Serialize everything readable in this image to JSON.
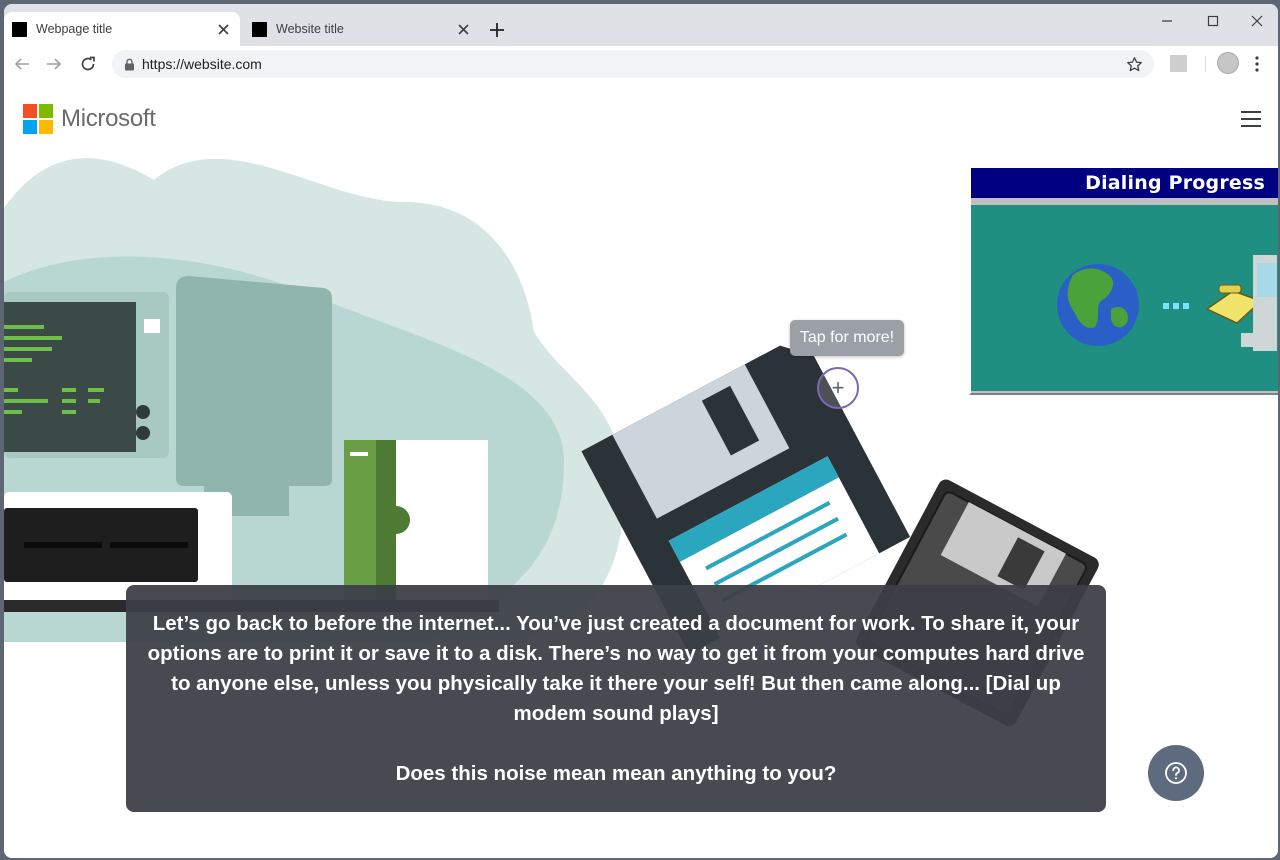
{
  "browser": {
    "tabs": [
      {
        "title": "Webpage title",
        "active": true
      },
      {
        "title": "Website title",
        "active": false
      }
    ],
    "url": "https://website.com"
  },
  "site": {
    "logo_text": "Microsoft",
    "logo_colors": [
      "#f25022",
      "#7fba00",
      "#00a4ef",
      "#ffb900"
    ]
  },
  "dialog": {
    "title": "Dialing Progress"
  },
  "hotspot": {
    "tooltip": "Tap for more!",
    "icon": "plus-icon"
  },
  "caption": {
    "paragraph": "Let’s go back to before the internet...  You’ve just created a document for work. To share it, your options are to print it or save it to a disk. There’s no way to get it from your computes hard drive to anyone else, unless you physically take it there your self! But then came along... [Dial up modem sound plays]",
    "question": "Does this noise mean mean anything to you?"
  },
  "help": {
    "icon": "question-icon"
  },
  "colors": {
    "caption_bg": "#3c4046",
    "help_button": "#5e6b7f",
    "dialog_title": "#000080",
    "dialog_panel": "#1e8f80"
  }
}
